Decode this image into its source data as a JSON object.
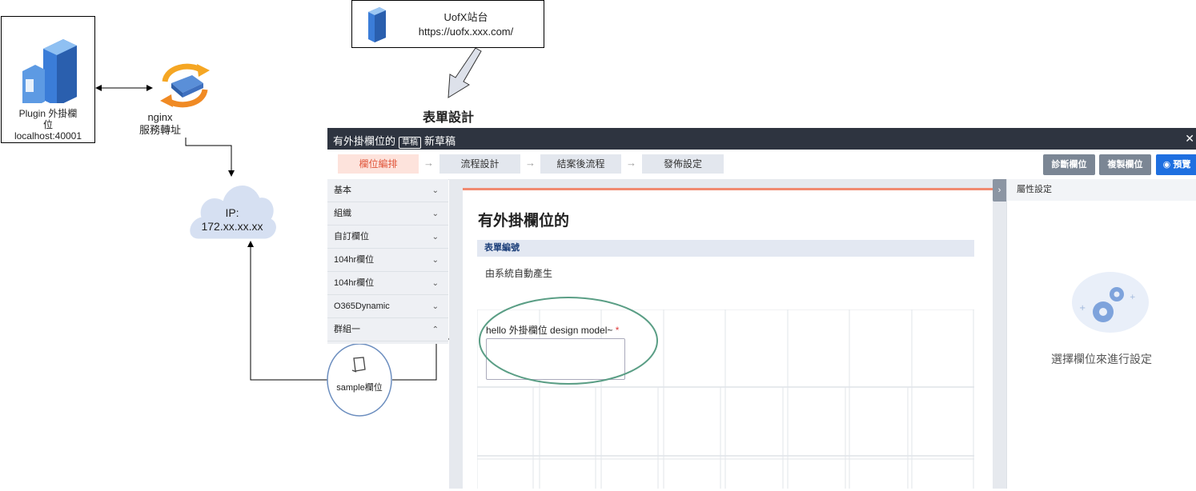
{
  "plugin": {
    "label_line1": "Plugin 外掛欄",
    "label_line2": "位",
    "label_line3": "localhost:40001"
  },
  "uofx": {
    "name": "UofX站台",
    "url": "https://uofx.xxx.com/"
  },
  "nginx": {
    "line1": "nginx",
    "line2": "服務轉址"
  },
  "cloud": {
    "line1": "IP:",
    "line2": "172.xx.xx.xx"
  },
  "design_title": "表單設計",
  "sample_label": "sample欄位",
  "app": {
    "title": "有外掛欄位的",
    "badge": "草稿",
    "subtitle": "新草稿",
    "close": "✕",
    "steps": [
      "欄位編排",
      "流程設計",
      "結案後流程",
      "發佈設定"
    ],
    "step_arrow": "→",
    "buttons": {
      "diagnose": "診斷欄位",
      "copy": "複製欄位",
      "preview": "預覽"
    },
    "left_items": [
      {
        "label": "基本",
        "chev": "⌄"
      },
      {
        "label": "組織",
        "chev": "⌄"
      },
      {
        "label": "自訂欄位",
        "chev": "⌄"
      },
      {
        "label": "104hr欄位",
        "chev": "⌄"
      },
      {
        "label": "104hr欄位",
        "chev": "⌄"
      },
      {
        "label": "O365Dynamic",
        "chev": "⌄"
      },
      {
        "label": "群組一",
        "chev": "⌃"
      }
    ],
    "form_title": "有外掛欄位的",
    "section_head": "表單編號",
    "section_value": "由系統自動產生",
    "field_label": "hello 外掛欄位 design model~",
    "required_mark": "*",
    "right_panel_title": "屬性設定",
    "right_panel_toggle": "›",
    "right_panel_empty": "選擇欄位來進行設定"
  },
  "colors": {
    "titlebar": "#2e3440",
    "accent_orange": "#f08a70",
    "preview_blue": "#1e6fe0",
    "ellipse_green": "#5a9e85",
    "circle_blue": "#6c8ebf"
  }
}
